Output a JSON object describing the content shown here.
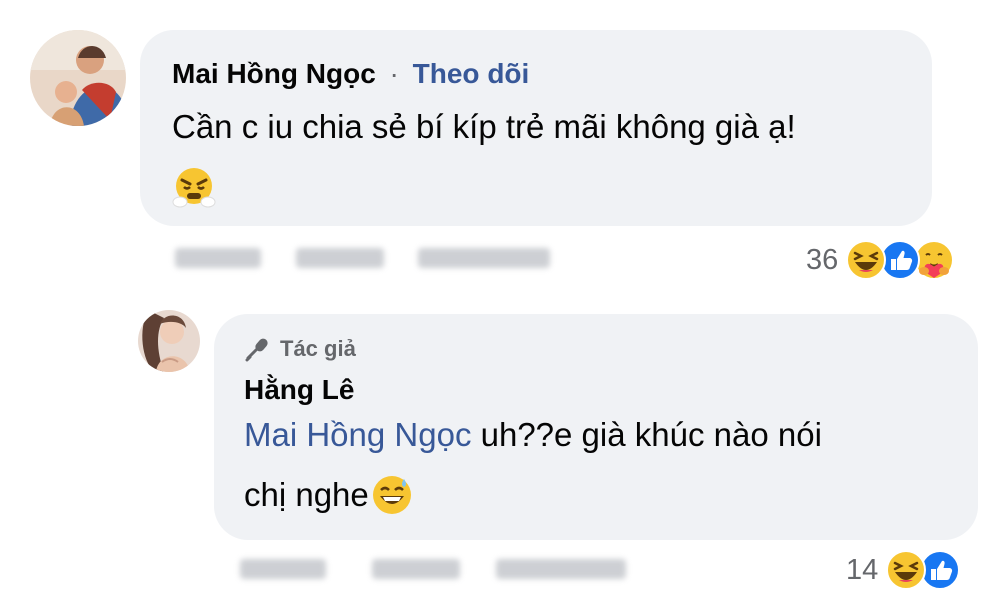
{
  "comment1": {
    "author": "Mai Hồng Ngọc",
    "separator": "·",
    "follow_label": "Theo dõi",
    "text": "Cần c iu chia sẻ bí kíp trẻ mãi không già ạ!",
    "reaction_count": "36"
  },
  "reply1": {
    "badge_label": "Tác giả",
    "author": "Hằng Lê",
    "mention": "Mai Hồng Ngọc",
    "text_after_mention": " uh??e già khúc nào nói",
    "text_line2": "chị nghe",
    "reaction_count": "14"
  },
  "colors": {
    "bubble": "#f0f2f5",
    "link_blue": "#385898",
    "muted": "#65676b"
  }
}
